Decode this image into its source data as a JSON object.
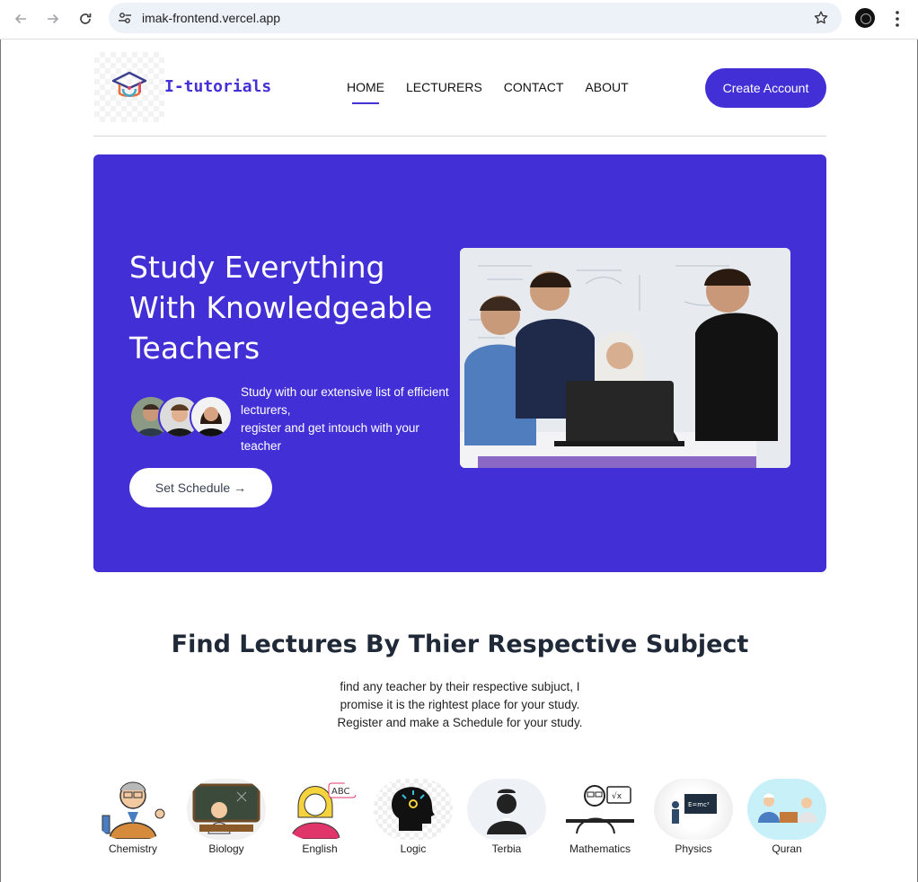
{
  "browser": {
    "url": "imak-frontend.vercel.app",
    "icons": [
      "back-arrow-icon",
      "forward-arrow-icon",
      "reload-icon",
      "site-settings-icon",
      "bookmark-star-icon",
      "profile-icon",
      "kebab-menu-icon"
    ]
  },
  "header": {
    "brand": "I-tutorials",
    "nav": [
      "HOME",
      "LECTURERS",
      "CONTACT",
      "ABOUT"
    ],
    "active_nav": "HOME",
    "cta": "Create Account"
  },
  "hero": {
    "title_lines": [
      "Study Everything",
      "With Knowledgeable",
      "Teachers"
    ],
    "description_lines": [
      "Study with our extensive list of efficient",
      "lecturers,",
      "register and get intouch with your",
      "teacher"
    ],
    "button": "Set Schedule →",
    "bg_color": "#432fd6"
  },
  "subjects_section": {
    "title": "Find Lectures By Thier Respective Subject",
    "description": "find any teacher by their respective subjuct, I promise it is the rightest place for your study. Register and make a Schedule for your study.",
    "subjects": [
      "Chemistry",
      "Biology",
      "English",
      "Logic",
      "Terbia",
      "Mathematics",
      "Physics",
      "Quran"
    ]
  },
  "colors": {
    "accent": "#432fd6"
  }
}
